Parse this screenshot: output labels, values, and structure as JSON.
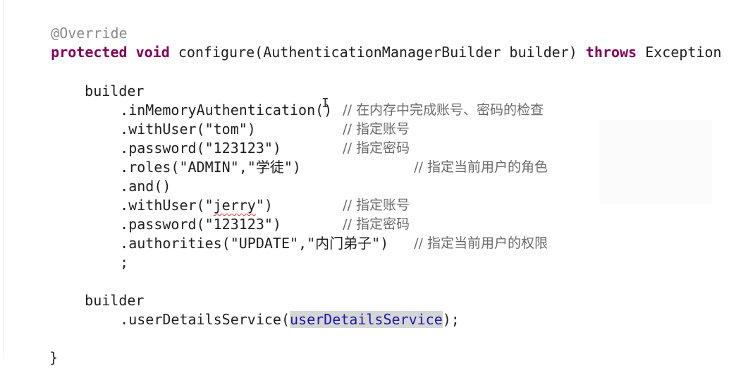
{
  "code": {
    "annotation": "@Override",
    "method_signature": {
      "protected": "protected",
      "void": "void",
      "name": "configure(AuthenticationManagerBuilder builder) ",
      "throws": "throws",
      "exception": " Exception {"
    },
    "builder1": "builder",
    "inMemoryAuthentication": ".inMemoryAuthentication()",
    "withUser1": ".withUser(\"tom\")",
    "password1": ".password(\"123123\")",
    "roles": ".roles(\"ADMIN\",\"学徒\")",
    "and": ".and()",
    "withUser2_prefix": ".withUser(\"",
    "withUser2_name": "jerry",
    "withUser2_suffix": "\")",
    "password2": ".password(\"123123\")",
    "authorities": ".authorities(\"UPDATE\",\"内门弟子\")",
    "semicolon": ";",
    "builder2": "builder",
    "userDetailsService_prefix": ".userDetailsService(",
    "userDetailsService_arg": "userDetailsService",
    "userDetailsService_suffix": ");",
    "closing_brace": "}"
  },
  "comments": {
    "c1": "// 在内存中完成账号、密码的检查",
    "c2": "// 指定账号",
    "c3": "// 指定密码",
    "c4": "// 指定当前用户的角色",
    "c5": "// 指定账号",
    "c6": "// 指定密码",
    "c7": "// 指定当前用户的权限"
  },
  "colors": {
    "keyword": "#7f0055",
    "annotation": "#8a8a8a",
    "selection": "#d6d6d6",
    "field": "#1a1aa6"
  }
}
